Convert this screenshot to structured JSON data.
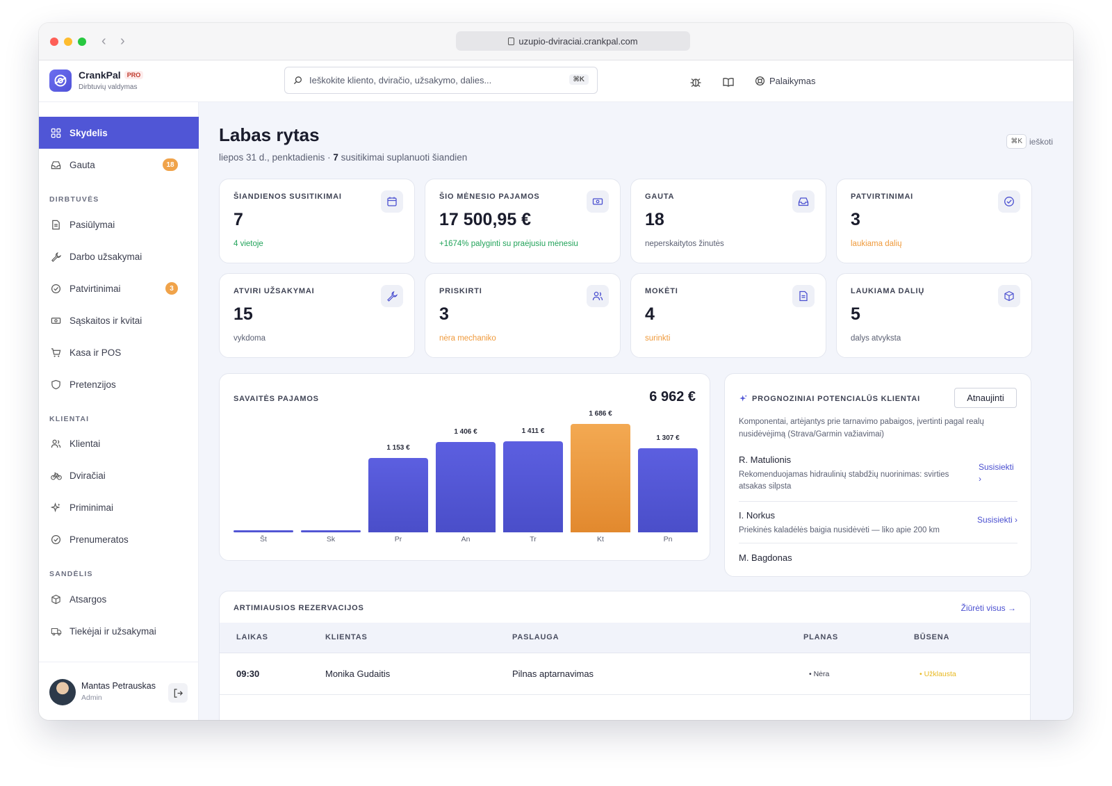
{
  "browser": {
    "url": "uzupio-dviraciai.crankpal.com"
  },
  "brand": {
    "name": "CrankPal",
    "tag": "PRO",
    "subtitle": "Dirbtuvių valdymas"
  },
  "search": {
    "placeholder": "Ieškokite kliento, dviračio, užsakymo, dalies...",
    "shortcut": "⌘K"
  },
  "topbar": {
    "support_label": "Palaikymas"
  },
  "sidebar": {
    "items": [
      {
        "label": "Skydelis"
      },
      {
        "label": "Gauta",
        "badge": "18"
      }
    ],
    "sections": [
      {
        "title": "DIRBTUVĖS",
        "items": [
          {
            "label": "Pasiūlymai"
          },
          {
            "label": "Darbo užsakymai"
          },
          {
            "label": "Patvirtinimai",
            "badge": "3"
          },
          {
            "label": "Sąskaitos ir kvitai"
          },
          {
            "label": "Kasa ir POS"
          },
          {
            "label": "Pretenzijos"
          }
        ]
      },
      {
        "title": "KLIENTAI",
        "items": [
          {
            "label": "Klientai"
          },
          {
            "label": "Dviračiai"
          },
          {
            "label": "Priminimai"
          },
          {
            "label": "Prenumeratos"
          }
        ]
      },
      {
        "title": "SANDĖLIS",
        "items": [
          {
            "label": "Atsargos"
          },
          {
            "label": "Tiekėjai ir užsakymai"
          }
        ]
      }
    ],
    "user": {
      "name": "Mantas Petrauskas",
      "role": "Admin"
    }
  },
  "header": {
    "greeting": "Labas rytas",
    "date_text": "liepos 31 d., penktadienis · ",
    "count": "7",
    "count_suffix": " susitikimai suplanuoti šiandien",
    "quick_key": "⌘K",
    "quick_label": "ieškoti"
  },
  "stats": [
    {
      "label": "ŠIANDIENOS SUSITIKIMAI",
      "value": "7",
      "note": "4 vietoje",
      "icon": "calendar-icon"
    },
    {
      "label": "ŠIO MĖNESIO PAJAMOS",
      "value": "17 500,95 €",
      "note": "+1674% palyginti su praėjusiu mėnesiu",
      "icon": "money-icon"
    },
    {
      "label": "GAUTA",
      "value": "18",
      "note": "neperskaitytos žinutės",
      "icon": "inbox-icon"
    },
    {
      "label": "PATVIRTINIMAI",
      "value": "3",
      "note": "laukiama dalių",
      "icon": "check-circle-icon"
    },
    {
      "label": "ATVIRI UŽSAKYMAI",
      "value": "15",
      "note": "vykdoma",
      "icon": "wrench-icon"
    },
    {
      "label": "PRISKIRTI",
      "value": "3",
      "note": "nėra mechaniko",
      "icon": "users-icon"
    },
    {
      "label": "MOKĖTI",
      "value": "4",
      "note": "surinkti",
      "icon": "document-icon"
    },
    {
      "label": "LAUKIAMA DALIŲ",
      "value": "5",
      "note": "dalys atvyksta",
      "icon": "box-icon"
    }
  ],
  "colors": {
    "accent": "#5056d6",
    "highlight": "#f0a34a",
    "positive": "#22a35a",
    "warning": "#ef9a3c"
  },
  "chart_data": {
    "type": "bar",
    "title": "SAVAITĖS PAJAMOS",
    "total": "6 962 €",
    "categories": [
      "Št",
      "Sk",
      "Pr",
      "An",
      "Tr",
      "Kt",
      "Pn"
    ],
    "values": [
      0,
      0,
      1153,
      1406,
      1411,
      1686,
      1307
    ],
    "labels": [
      "",
      "",
      "1 153 €",
      "1 406 €",
      "1 411 €",
      "1 686 €",
      "1 307 €"
    ],
    "highlight_index": 5,
    "ylim": [
      0,
      1686
    ],
    "grid": false
  },
  "leads": {
    "title": "PROGNOZINIAI POTENCIALŪS KLIENTAI",
    "refresh_label": "Atnaujinti",
    "description": "Komponentai, artėjantys prie tarnavimo pabaigos, įvertinti pagal realų nusidėvėjimą (Strava/Garmin važiavimai)",
    "items": [
      {
        "name": "R. Matulionis",
        "desc": "Rekomenduojamas hidraulinių stabdžių nuorinimas: svirties atsakas silpsta",
        "link": "Susisiekti ›"
      },
      {
        "name": "I. Norkus",
        "desc": "Priekinės kaladėlės baigia nusidėvėti — liko apie 200 km",
        "link": "Susisiekti ›"
      },
      {
        "name": "M. Bagdonas",
        "desc": "",
        "link": ""
      }
    ]
  },
  "reservations": {
    "title": "ARTIMIAUSIOS REZERVACIJOS",
    "view_all": "Žiūrėti visus →",
    "columns": [
      "LAIKAS",
      "KLIENTAS",
      "PASLAUGA",
      "PLANAS",
      "BŪSENA"
    ],
    "rows": [
      {
        "time": "09:30",
        "client": "Monika Gudaitis",
        "service": "Pilnas aptarnavimas",
        "plan": "• Nėra",
        "status": "• Užklausta"
      }
    ]
  }
}
